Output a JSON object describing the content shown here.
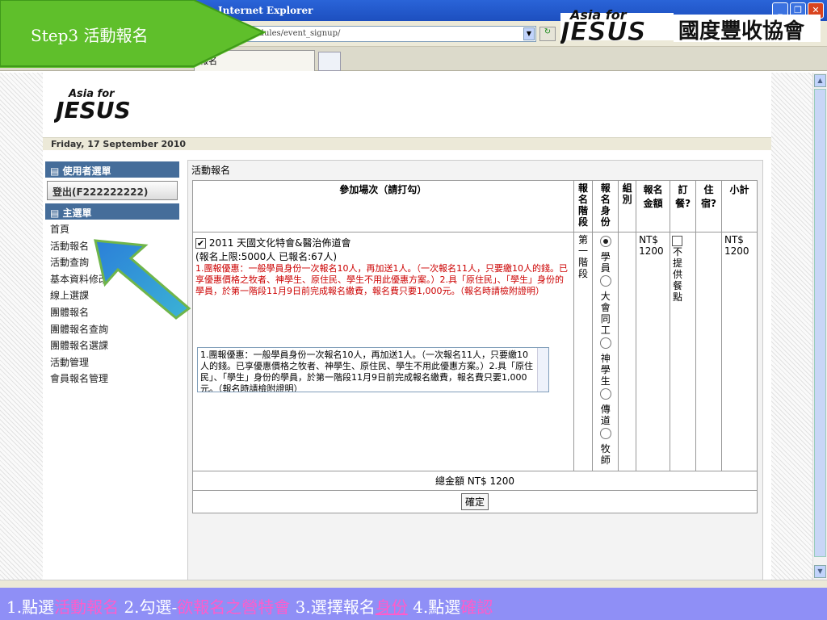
{
  "browser": {
    "title": "Internet Explorer",
    "address": "...odules/event_signup/",
    "tab_label": "報名"
  },
  "overlay": {
    "step_label": "Step3 活動報名",
    "bottom": {
      "p1": "1.點選",
      "h1": "活動報名",
      "p2": " 2.勾選-",
      "h2": "欲報名之營特會",
      "p3": " 3.選擇報名",
      "h3": "身份",
      "p4": " 4.點選",
      "h4": "確認"
    }
  },
  "header": {
    "logo_top": "Asia for",
    "logo_bottom": "JESUS",
    "org": "國度豐收協會",
    "date": "Friday, 17 September 2010"
  },
  "sidebar": {
    "user_menu": "使用者選單",
    "logout": "登出(F222222222)",
    "main_menu": "主選單",
    "items": [
      "首頁",
      "活動報名",
      "活動查詢",
      "基本資料修改",
      "線上選課",
      "團體報名",
      "團體報名查詢",
      "團體報名選課",
      "活動管理",
      "會員報名管理"
    ]
  },
  "main": {
    "title": "活動報名",
    "headers": {
      "event": "參加場次（請打勾）",
      "stage": "報名階段",
      "identity": "報名身份",
      "group": "組別",
      "fee": "報名金額",
      "meal": "訂餐?",
      "lodging": "住宿?",
      "subtotal": "小計"
    },
    "event": {
      "name": "2011 天國文化特會&醫治佈道會",
      "limit": "(報名上限:5000人 已報名:67人)",
      "red_note": "1.團報優惠：一般學員身份一次報名10人，再加送1人。（一次報名11人，只要繳10人的錢。已享優惠價格之牧者、神學生、原住民、學生不用此優惠方案。）2.具「原住民」、「學生」身份的學員，於第一階段11月9日前完成報名繳費，報名費只要1,000元。（報名時請檢附證明）",
      "textarea": "1.團報優惠：一般學員身份一次報名10人，再加送1人。（一次報名11人，只要繳10人的錢。已享優惠價格之牧者、神學生、原住民、學生不用此優惠方案。）2.具「原住民」、「學生」身份的學員，於第一階段11月9日前完成報名繳費，報名費只要1,000元。（報名時請檢附證明）",
      "stage": "第一階段",
      "identities": [
        "學員",
        "大會同工",
        "神學生",
        "傳道",
        "牧師"
      ],
      "fee": "NT$ 1200",
      "meal": "不提供餐點",
      "subtotal": "NT$ 1200"
    },
    "total": "總金額 NT$ 1200",
    "confirm": "確定"
  }
}
